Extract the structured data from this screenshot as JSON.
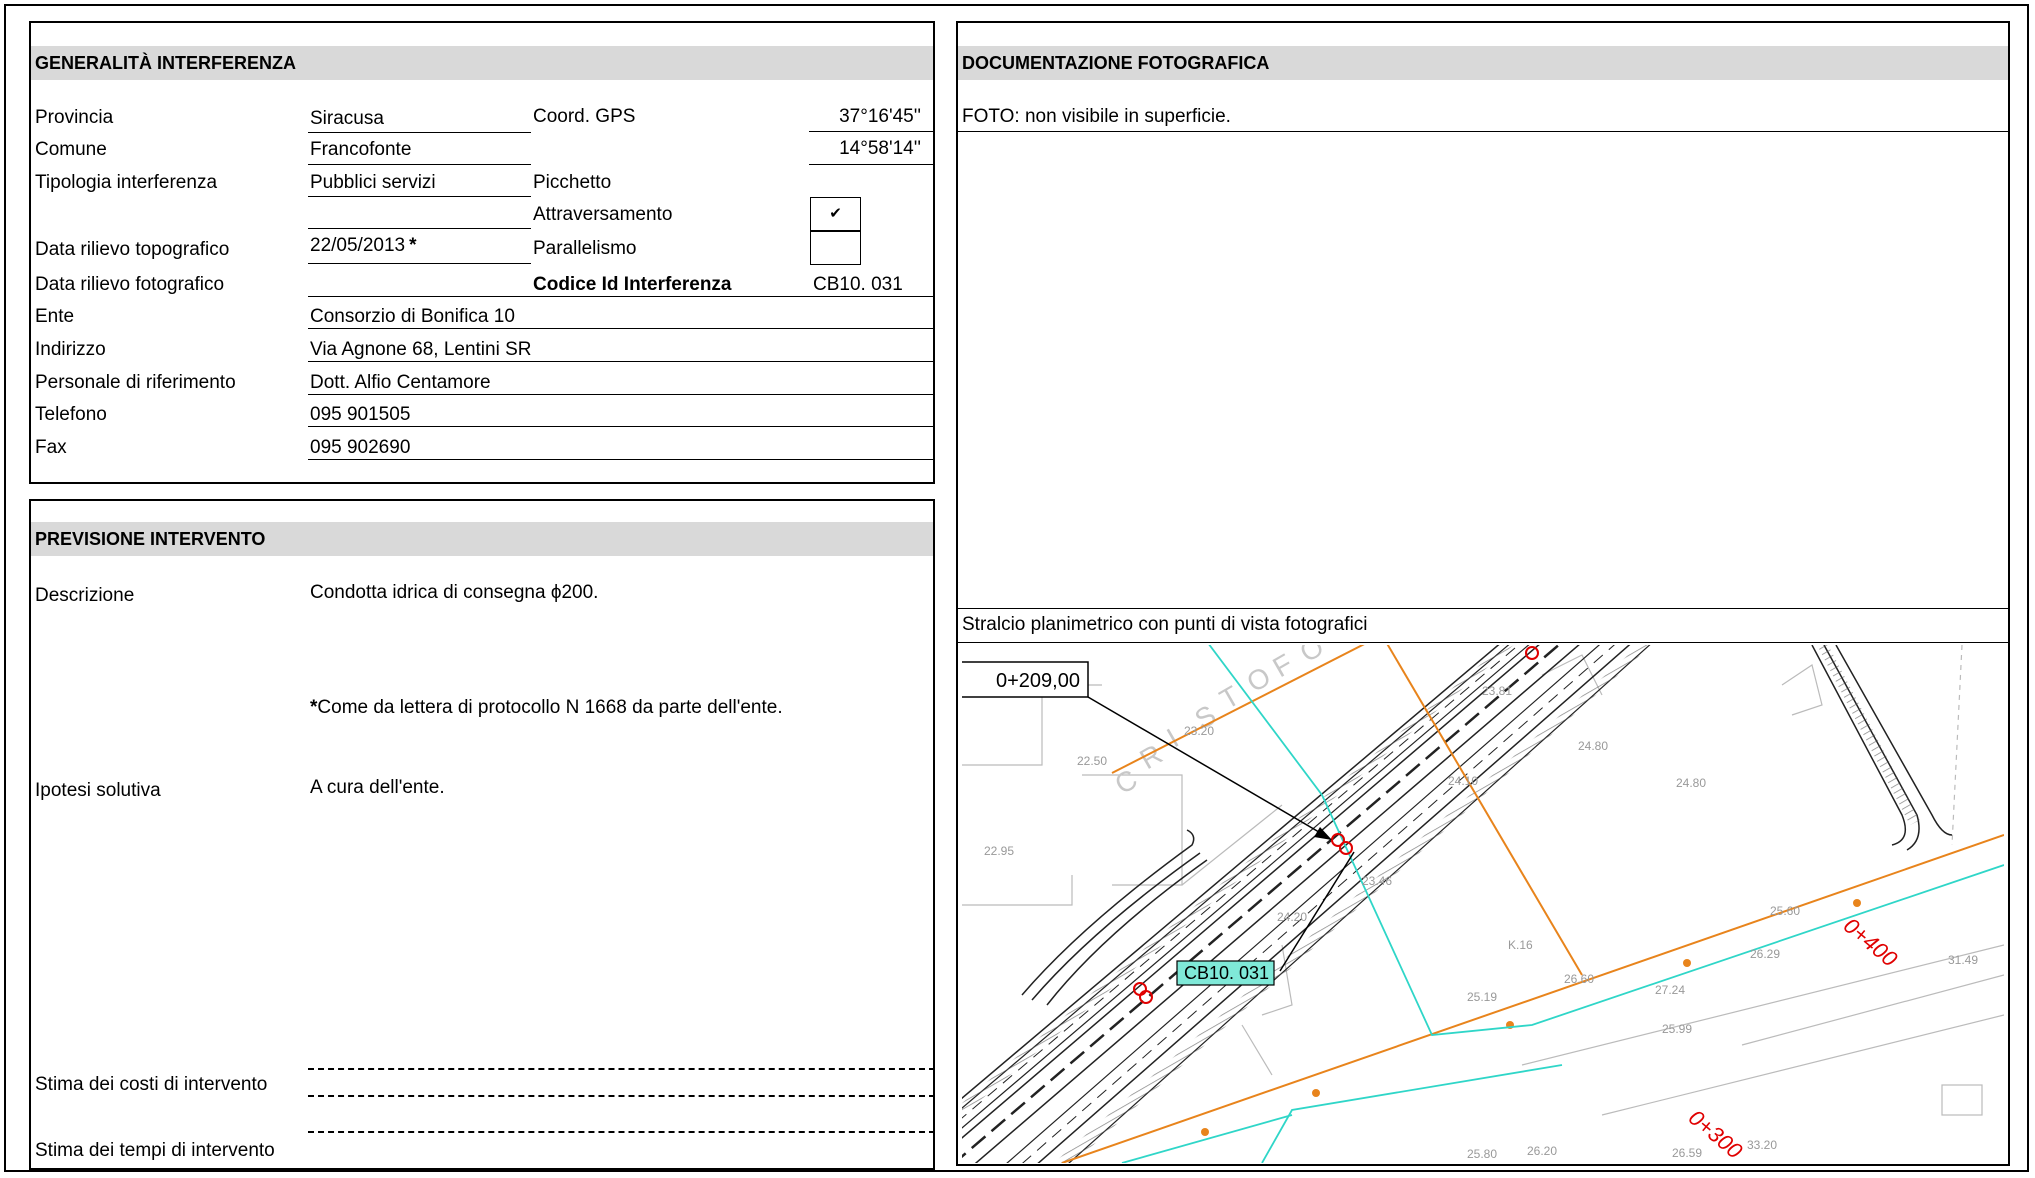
{
  "generalita": {
    "title": "GENERALITÀ  INTERFERENZA",
    "provincia_label": "Provincia",
    "provincia_value": "Siracusa",
    "comune_label": "Comune",
    "comune_value": "Francofonte",
    "tipologia_label": "Tipologia interferenza",
    "tipologia_value": "Pubblici servizi",
    "data_topo_label": "Data rilievo topografico",
    "data_topo_value": "22/05/2013",
    "data_topo_mark": "*",
    "data_foto_label": "Data rilievo fotografico",
    "data_foto_value": "",
    "ente_label": "Ente",
    "ente_value": "Consorzio di Bonifica 10",
    "indirizzo_label": "Indirizzo",
    "indirizzo_value": "Via Agnone 68, Lentini SR",
    "personale_label": "Personale di riferimento",
    "personale_value": "Dott. Alfio Centamore",
    "telefono_label": "Telefono",
    "telefono_value": "095 901505",
    "fax_label": "Fax",
    "fax_value": "095 902690",
    "coord_label": "Coord. GPS",
    "coord_lat": "37°16'45''",
    "coord_lon": "14°58'14''",
    "picchetto_label": "Picchetto",
    "attraversamento_label": "Attraversamento",
    "attraversamento_checked": true,
    "check_glyph": "✔",
    "parallelismo_label": "Parallelismo",
    "parallelismo_checked": false,
    "codice_label": "Codice Id Interferenza",
    "codice_value": "CB10. 031"
  },
  "previsione": {
    "title": "PREVISIONE INTERVENTO",
    "descrizione_label": "Descrizione",
    "descrizione_value": "Condotta idrica di consegna ϕ200.",
    "note_mark": "*",
    "note_text": "Come da lettera di protocollo N 1668 da parte dell'ente.",
    "ipotesi_label": "Ipotesi solutiva",
    "ipotesi_value": "A cura dell'ente.",
    "costi_label": "Stima dei costi di intervento",
    "tempi_label": "Stima dei tempi di intervento"
  },
  "documentazione": {
    "title": "DOCUMENTAZIONE FOTOGRAFICA",
    "foto_text": "FOTO:  non visibile in superficie.",
    "stralcio_label": "Stralcio planimetrico con punti di vista fotografici"
  },
  "map": {
    "chainage_callout": "0+209,00",
    "interference_tag": "CB10. 031",
    "km_400": "0+400",
    "km_300": "0+300",
    "street_letters": [
      "C",
      "R",
      "I",
      "S",
      "T",
      "O",
      "F",
      "O"
    ],
    "spot_heights": [
      "23.81",
      "23.20",
      "22.50",
      "24.80",
      "24.10",
      "24.80",
      "22.95",
      "23.46",
      "24.20",
      "25.60",
      "26.29",
      "26.60",
      "27.24",
      "25.99",
      "25.19",
      "25.80",
      "26.59",
      "26.20",
      "33.20",
      "31.49",
      "K.16"
    ],
    "colors": {
      "orange": "#e8841c",
      "cyan": "#2fd6c8",
      "red": "#e00000",
      "tag_bg": "#7fe9d8"
    }
  }
}
